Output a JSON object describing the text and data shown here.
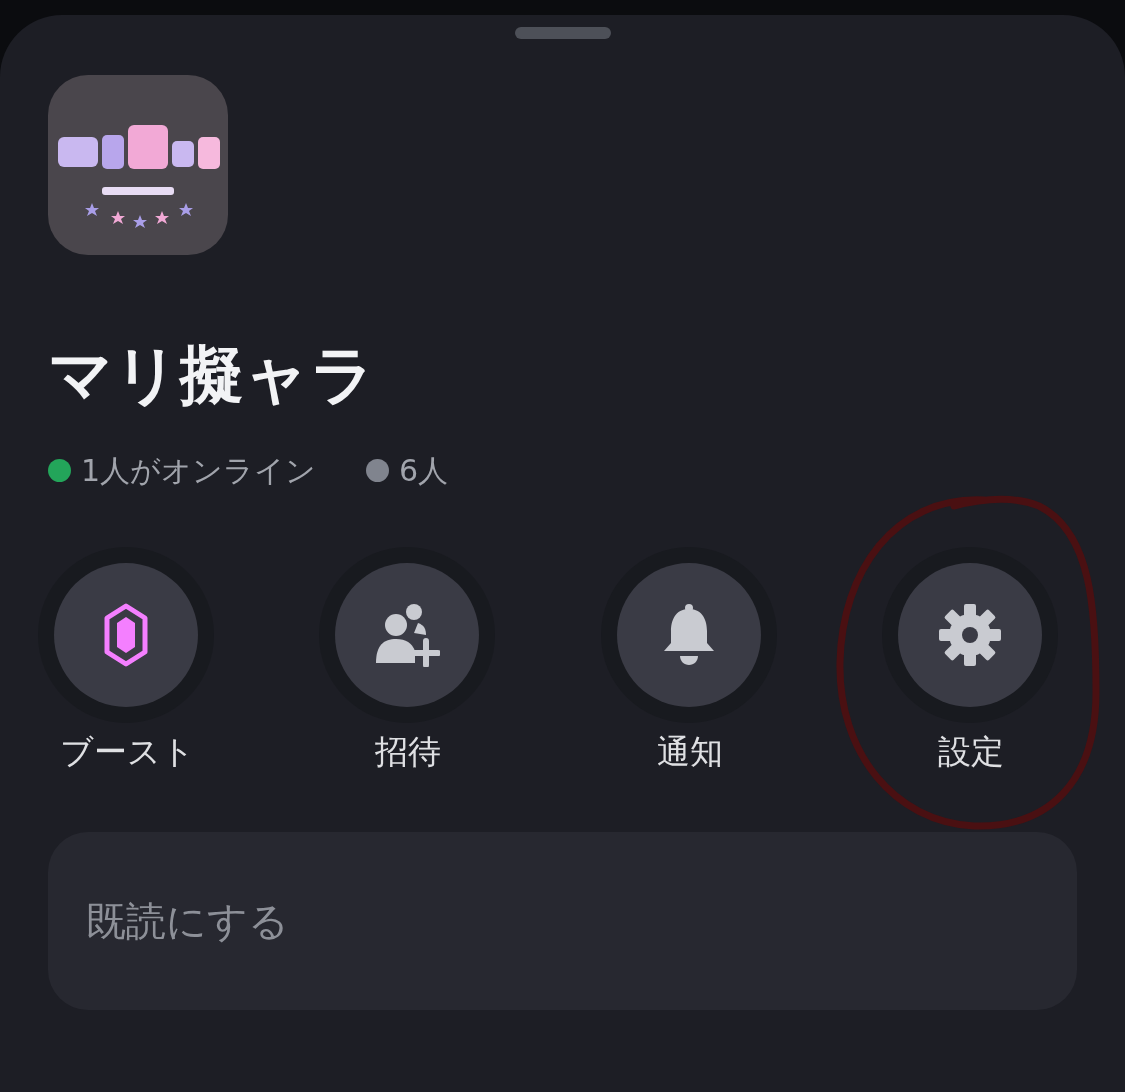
{
  "server": {
    "name": "マリ擬ャラ"
  },
  "members": [
    {
      "text": "1人がオンライン",
      "color": "#23a55a"
    },
    {
      "text": "6人",
      "color": "#80848e"
    }
  ],
  "actions": [
    {
      "kind": "boost",
      "label": "ブースト",
      "circled": false
    },
    {
      "kind": "invite",
      "label": "招待",
      "circled": false
    },
    {
      "kind": "notify",
      "label": "通知",
      "circled": false
    },
    {
      "kind": "settings",
      "label": "設定",
      "circled": true
    }
  ],
  "mark_read": {
    "label": "既読にする"
  }
}
